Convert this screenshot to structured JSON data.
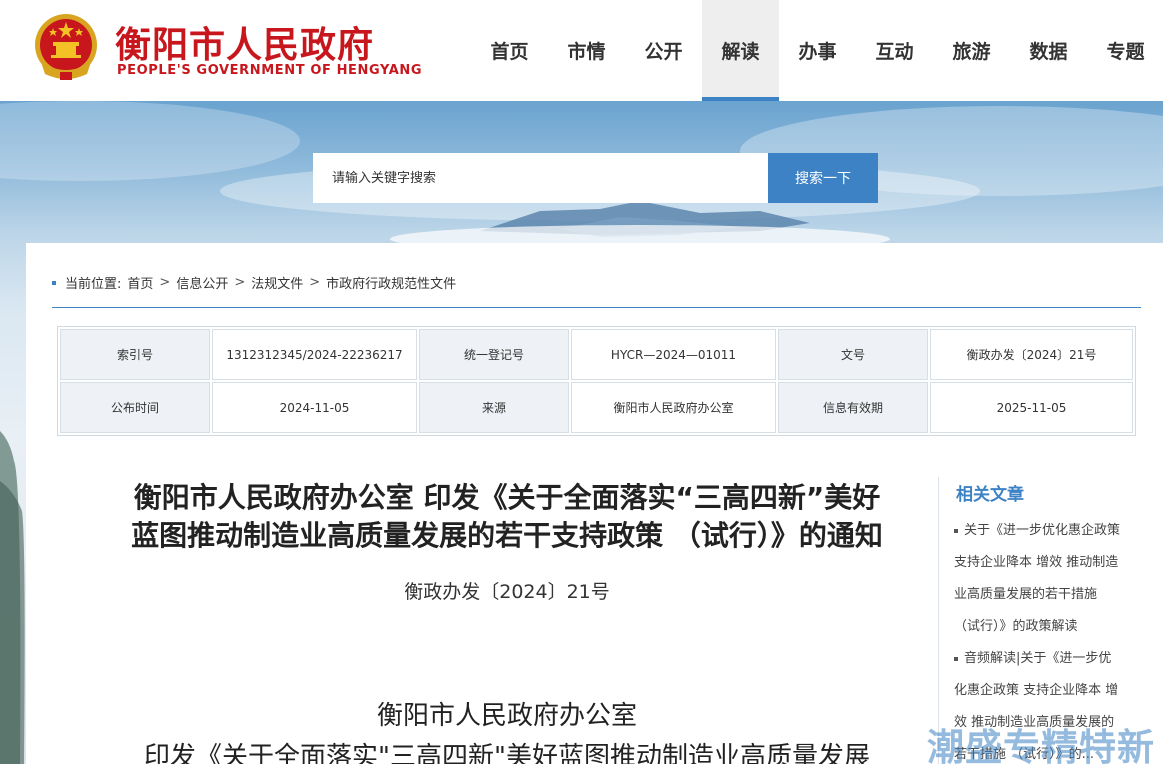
{
  "header": {
    "title": "衡阳市人民政府",
    "subtitle": "PEOPLE'S GOVERNMENT OF HENGYANG"
  },
  "nav": [
    {
      "label": "首页"
    },
    {
      "label": "市情"
    },
    {
      "label": "公开"
    },
    {
      "label": "解读"
    },
    {
      "label": "办事"
    },
    {
      "label": "互动"
    },
    {
      "label": "旅游"
    },
    {
      "label": "数据"
    },
    {
      "label": "专题"
    }
  ],
  "search": {
    "placeholder": "请输入关键字搜索",
    "button": "搜索一下"
  },
  "breadcrumb": {
    "prefix": "当前位置:",
    "items": [
      "首页",
      "信息公开",
      "法规文件",
      "市政府行政规范性文件"
    ]
  },
  "meta": {
    "index_label": "索引号",
    "index_value": "1312312345/2024-22236217",
    "reg_label": "统一登记号",
    "reg_value": "HYCR—2024—01011",
    "doc_label": "文号",
    "doc_value": "衡政办发〔2024〕21号",
    "date_label": "公布时间",
    "date_value": "2024-11-05",
    "source_label": "来源",
    "source_value": "衡阳市人民政府办公室",
    "valid_label": "信息有效期",
    "valid_value": "2025-11-05"
  },
  "article": {
    "title_line1": "衡阳市人民政府办公室 印发《关于全面落实“三高四新”美好",
    "title_line2": "蓝图推动制造业高质量发展的若干支持政策 （试行）》的通知",
    "doc_number": "衡政办发〔2024〕21号",
    "issuer": "衡阳市人民政府办公室",
    "body_title": "印发《关于全面落实\"三高四新\"美好蓝图推动制造业高质量发展"
  },
  "sidebar": {
    "title": "相关文章",
    "items": [
      {
        "line1": "关于《进一步优化惠企政策",
        "line2": "支持企业降本 增效 推动制造",
        "line3": "业高质量发展的若干措施",
        "line4": "（试行）》的政策解读"
      },
      {
        "line1": "音频解读|关于《进一步优",
        "line2": "化惠企政策 支持企业降本 增",
        "line3": "效 推动制造业高质量发展的",
        "line4": "若干措施 （试行）》的..."
      }
    ]
  },
  "watermark": "潮盛专精特新",
  "colors": {
    "brand_red": "#c8161d",
    "accent_blue": "#3d82c4"
  }
}
